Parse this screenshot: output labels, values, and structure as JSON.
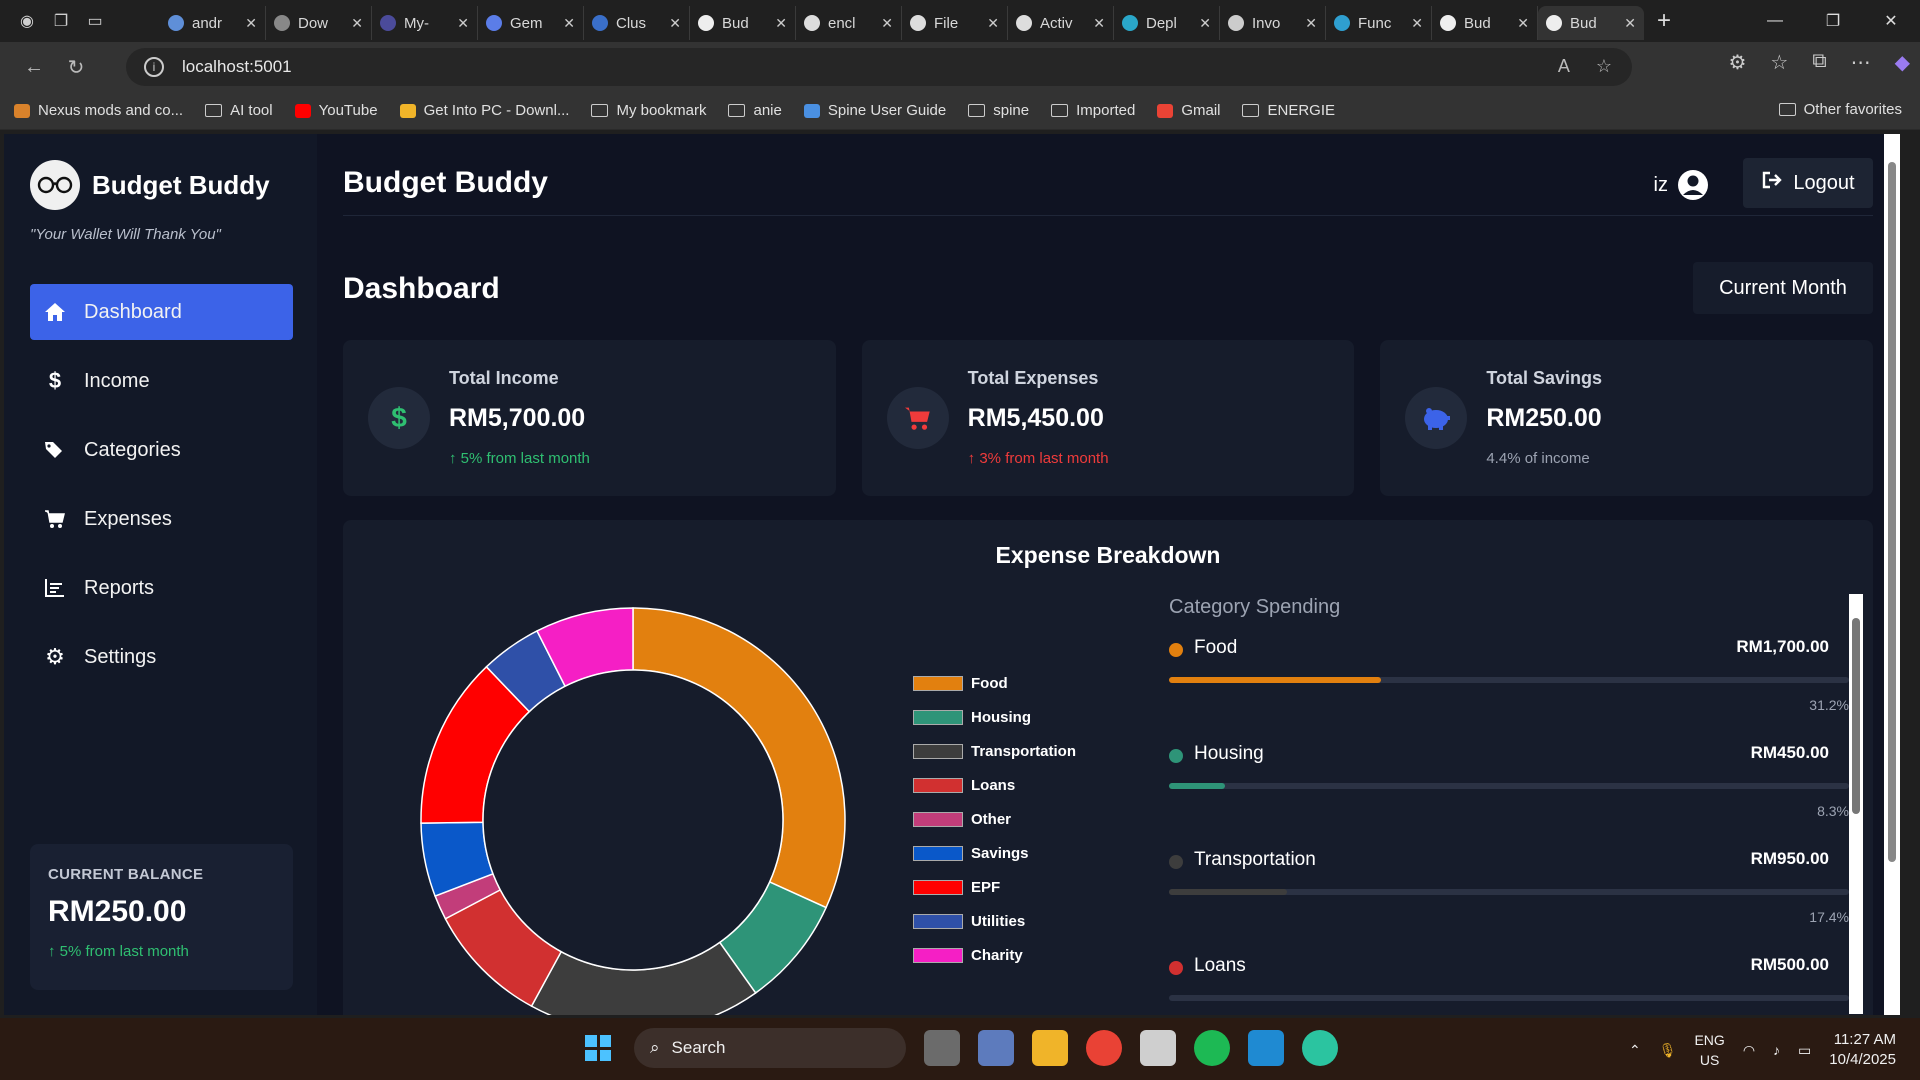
{
  "browser": {
    "tabs": [
      {
        "label": "andr",
        "fav_color": "#5f8fd8"
      },
      {
        "label": "Dow",
        "fav_color": "#888888"
      },
      {
        "label": "My-",
        "fav_color": "#4b4b9a"
      },
      {
        "label": "Gem",
        "fav_color": "#5b7de8"
      },
      {
        "label": "Clus",
        "fav_color": "#3a6fc9"
      },
      {
        "label": "Bud",
        "fav_color": "#eeeeee"
      },
      {
        "label": "encl",
        "fav_color": "#dddddd"
      },
      {
        "label": "File",
        "fav_color": "#dddddd"
      },
      {
        "label": "Activ",
        "fav_color": "#dddddd"
      },
      {
        "label": "Depl",
        "fav_color": "#2aa7c9"
      },
      {
        "label": "Invo",
        "fav_color": "#cccccc"
      },
      {
        "label": "Func",
        "fav_color": "#2f9fd0"
      },
      {
        "label": "Bud",
        "fav_color": "#eeeeee"
      },
      {
        "label": "Bud",
        "fav_color": "#eeeeee"
      }
    ],
    "url": "localhost:5001",
    "bookmarks": [
      {
        "label": "Nexus mods and co..."
      },
      {
        "label": "AI tool"
      },
      {
        "label": "YouTube"
      },
      {
        "label": "Get Into PC - Downl..."
      },
      {
        "label": "My bookmark"
      },
      {
        "label": "anie"
      },
      {
        "label": "Spine User Guide"
      },
      {
        "label": "spine"
      },
      {
        "label": "Imported"
      },
      {
        "label": "Gmail"
      },
      {
        "label": "ENERGIE"
      }
    ],
    "other_favorites": "Other favorites"
  },
  "sidebar": {
    "brand": "Budget Buddy",
    "tagline": "\"Your Wallet Will Thank You\"",
    "menu": [
      {
        "label": "Dashboard",
        "icon": "home-icon"
      },
      {
        "label": "Income",
        "icon": "dollar-icon"
      },
      {
        "label": "Categories",
        "icon": "tags-icon"
      },
      {
        "label": "Expenses",
        "icon": "cart-icon"
      },
      {
        "label": "Reports",
        "icon": "chart-icon"
      },
      {
        "label": "Settings",
        "icon": "gear-icon"
      }
    ],
    "balance": {
      "label": "CURRENT BALANCE",
      "value": "RM250.00",
      "change": "5% from last month"
    }
  },
  "header": {
    "title": "Budget Buddy",
    "user": "iz",
    "logout": "Logout"
  },
  "dashboard": {
    "title": "Dashboard",
    "period": "Current Month",
    "cards": [
      {
        "label": "Total Income",
        "value": "RM5,700.00",
        "change": "5% from last month",
        "trend": "up",
        "icon": "dollar-icon",
        "color": "#2fbf71"
      },
      {
        "label": "Total Expenses",
        "value": "RM5,450.00",
        "change": "3% from last month",
        "trend": "down",
        "icon": "cart-icon",
        "color": "#ef3b3b"
      },
      {
        "label": "Total Savings",
        "value": "RM250.00",
        "change": "4.4% of income",
        "trend": "neutral",
        "icon": "piggy-bank-icon",
        "color": "#3c63e8"
      }
    ]
  },
  "breakdown": {
    "title": "Expense Breakdown",
    "category_title": "Category Spending",
    "categories": [
      {
        "name": "Food",
        "amount": "RM1,700.00",
        "pct": "31.2%",
        "color": "#e2800f"
      },
      {
        "name": "Housing",
        "amount": "RM450.00",
        "pct": "8.3%",
        "color": "#2e9478"
      },
      {
        "name": "Transportation",
        "amount": "RM950.00",
        "pct": "17.4%",
        "color": "#3d3d3d"
      },
      {
        "name": "Loans",
        "amount": "RM500.00",
        "pct": "",
        "color": "#d13030"
      }
    ]
  },
  "chart_data": {
    "type": "pie",
    "title": "Expense Breakdown",
    "categories": [
      "Food",
      "Housing",
      "Transportation",
      "Loans",
      "Other",
      "Savings",
      "EPF",
      "Utilities",
      "Charity"
    ],
    "values": [
      1700,
      450,
      950,
      500,
      100,
      300,
      700,
      250,
      400
    ],
    "colors": [
      "#e2800f",
      "#2e9478",
      "#3d3d3d",
      "#d13030",
      "#c23d7a",
      "#0a58c9",
      "#ff0000",
      "#2f50a8",
      "#f51fc5"
    ],
    "legend": "right"
  },
  "taskbar": {
    "search": "Search",
    "lang": "ENG",
    "region": "US",
    "time": "11:27 AM",
    "date": "10/4/2025"
  }
}
